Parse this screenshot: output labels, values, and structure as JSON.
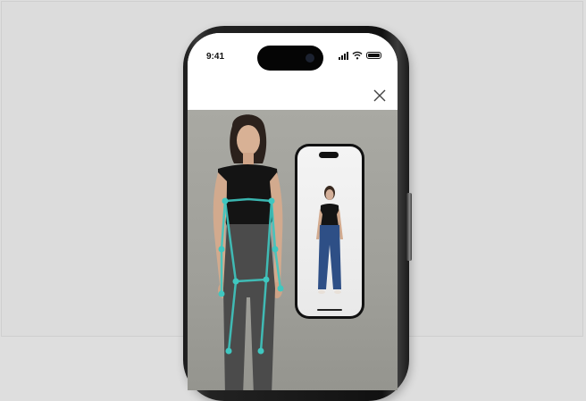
{
  "status_bar": {
    "time": "9:41",
    "icons": [
      "cellular-signal-icon",
      "wifi-icon",
      "battery-icon"
    ]
  },
  "header": {
    "close_icon": "close-icon"
  },
  "camera_view": {
    "subject": "person",
    "pose_overlay_color": "#3fc7c0"
  },
  "preview": {
    "subject": "person"
  },
  "colors": {
    "background": "#dedede",
    "phone_body": "#1a1a1a",
    "overlay": "#3fc7c0"
  }
}
